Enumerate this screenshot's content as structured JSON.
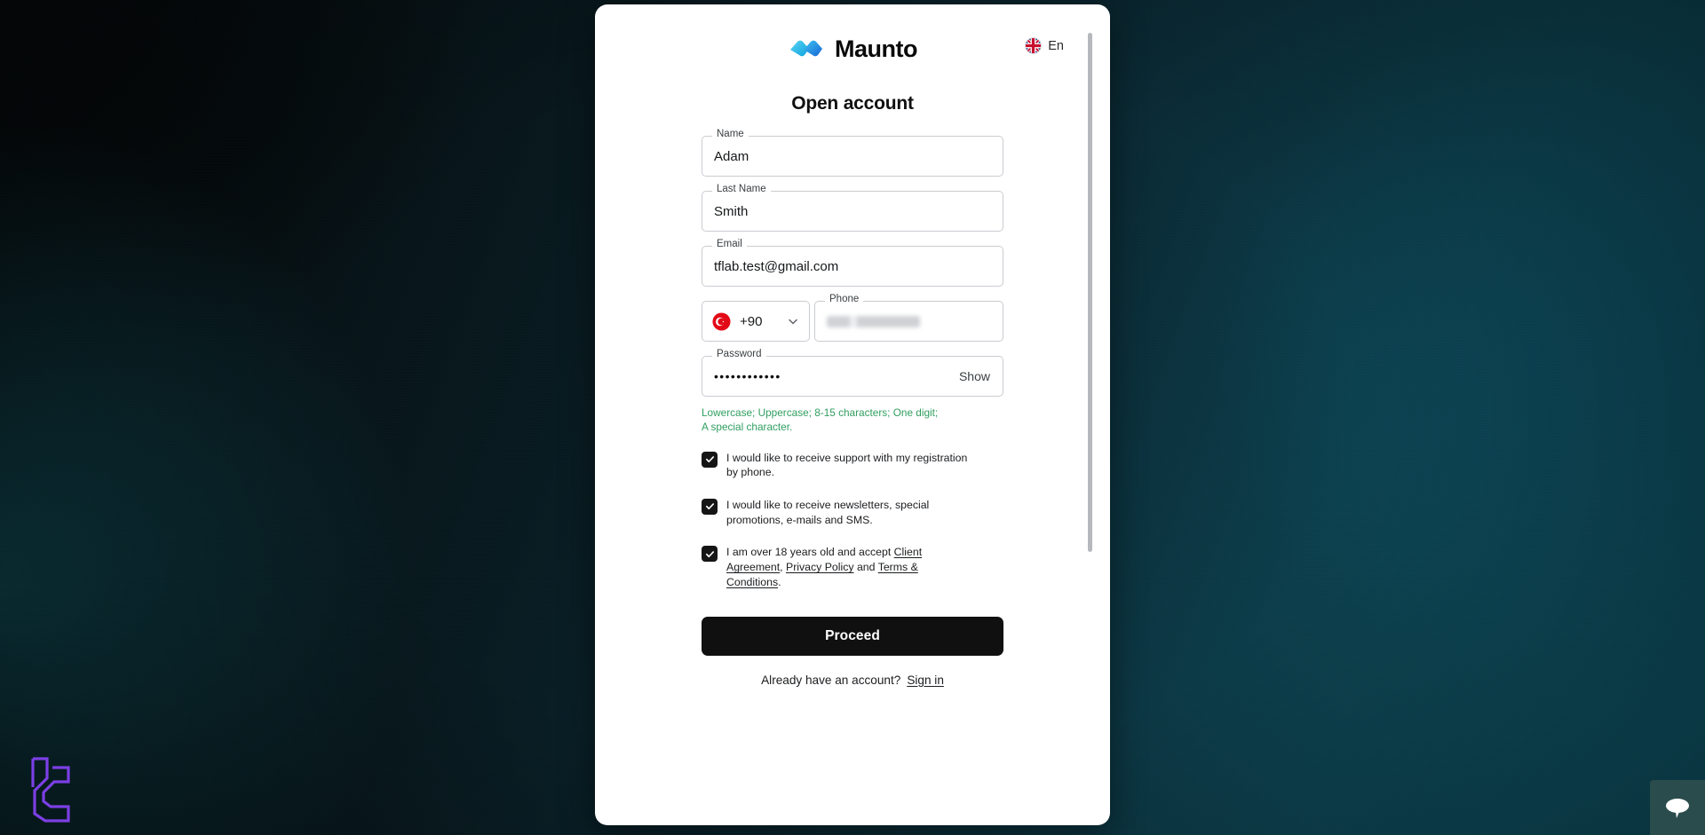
{
  "brand": {
    "name": "Maunto",
    "logo_icon": "maunto-chevrons-logo"
  },
  "header": {
    "language": {
      "label": "En",
      "flag_icon": "uk-flag-icon"
    }
  },
  "page": {
    "title": "Open account"
  },
  "form": {
    "fields": [
      {
        "label": "Name",
        "value": "Adam",
        "name": "name"
      },
      {
        "label": "Last Name",
        "value": "Smith",
        "name": "last-name"
      },
      {
        "label": "Email",
        "value": "tflab.test@gmail.com",
        "name": "email"
      }
    ],
    "phone": {
      "country_code": "+90",
      "country_flag_icon": "turkey-flag-icon",
      "dropdown_icon": "chevron-down-icon",
      "label": "Phone",
      "value": "",
      "placeholder": ""
    },
    "password": {
      "label": "Password",
      "value": "••••••••••••",
      "show_label": "Show",
      "hint": "Lowercase; Uppercase; 8-15 characters; One digit; A special character.",
      "hint_color": "#2f9e5f"
    },
    "consents": [
      {
        "name": "support-by-phone",
        "checked": true,
        "text": "I would like to receive support with my registration by phone."
      },
      {
        "name": "newsletters",
        "checked": true,
        "text": "I would like to receive newsletters, special promotions, e-mails and SMS."
      }
    ],
    "age_consent": {
      "name": "age-and-terms",
      "checked": true,
      "prefix": "I am over 18 years old and accept ",
      "link1": "Client Agreement",
      "separator1": ", ",
      "link2": "Privacy Policy",
      "separator2": " and ",
      "link3": "Terms & Conditions",
      "suffix": "."
    },
    "submit_label": "Proceed",
    "signin_prompt": "Already have an account?",
    "signin_link": "Sign in"
  },
  "widgets": {
    "chat_icon": "chat-bubble-icon",
    "watermark_icon": "lc-monogram-logo"
  },
  "colors": {
    "accent_dark": "#101010",
    "hint_green": "#2f9e5f",
    "flag_red": "#e30a17",
    "logo_blue": "#1a8fe3",
    "watermark_purple": "#7b3fe4",
    "background_teal": "#0e5566"
  }
}
